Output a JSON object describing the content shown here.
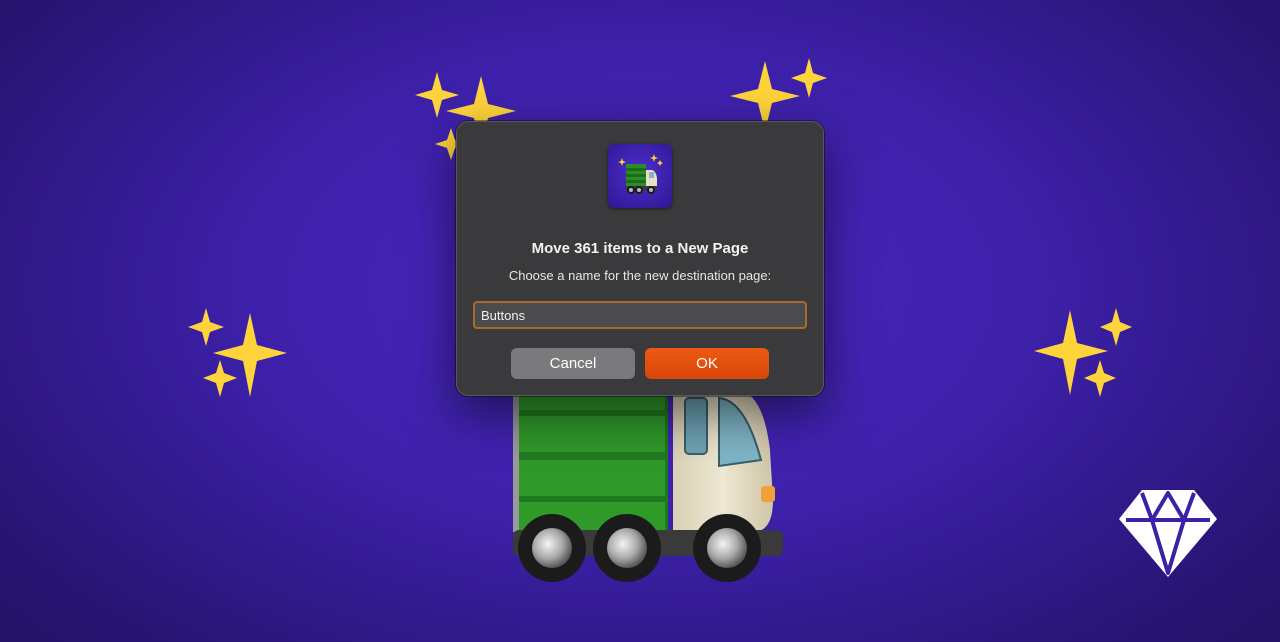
{
  "dialog": {
    "title": "Move 361 items to a New Page",
    "subtitle": "Choose a name for the new destination page:",
    "input_value": "Buttons",
    "cancel_label": "Cancel",
    "ok_label": "OK",
    "app_icon": "truck-with-sparkles-icon"
  },
  "background": {
    "icons": [
      "sparkles-icon",
      "delivery-truck-icon",
      "sketch-diamond-logo"
    ]
  },
  "colors": {
    "background": "#3c20a8",
    "dialog": "#3a3a3c",
    "ok_button": "#e04f0c",
    "cancel_button": "#7a7a7c",
    "input_focus": "#a86a2a"
  }
}
